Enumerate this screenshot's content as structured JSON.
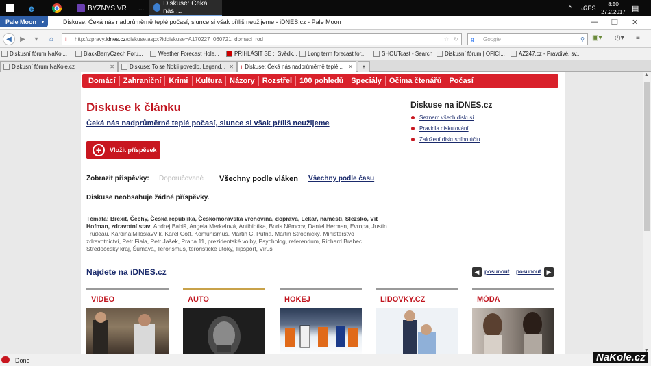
{
  "taskbar": {
    "items": [
      "BYZNYS VR",
      "...",
      "Diskuse: Čeká nás ..."
    ],
    "lang": "CES",
    "time": "8:50",
    "date": "27.2.2017"
  },
  "browser": {
    "app_button": "Pale Moon",
    "window_title": "Diskuse: Čeká nás nadprůměrně teplé počasí, slunce si však příliš neužijeme - iDNES.cz - Pale Moon",
    "url_prefix": "http://zpravy.",
    "url_domain": "idnes.cz",
    "url_path": "/diskuse.aspx?iddiskuse=A170227_060721_domaci_rod",
    "search_engine": "Google",
    "status": "Done"
  },
  "bookmarks": [
    "Diskusní fórum NaKol...",
    "BlackBerryCzech Foru...",
    "Weather Forecast Hole...",
    "PŘIHLÁSIT SE :: Svědk...",
    "Long term forecast for...",
    "SHOUTcast - Search",
    "Diskusní fórum | OFICI...",
    "AZ247.cz - Pravdivé, sv..."
  ],
  "tabs": [
    "Diskusní fórum NaKole.cz",
    "Diskuse: To se Nokii povedlo. Legend...",
    "Diskuse: Čeká nás nadprůměrně teplé..."
  ],
  "categories": [
    "Domácí",
    "Zahraniční",
    "Krimi",
    "Kultura",
    "Názory",
    "Rozstřel",
    "100 pohledů",
    "Speciály",
    "Očima čtenářů",
    "Počasí"
  ],
  "main": {
    "heading": "Diskuse k článku",
    "article_link": "Čeká nás nadprůměrně teplé počasí, slunce si však příliš neužijeme",
    "post_button": "Vložit příspěvek",
    "show_label": "Zobrazit příspěvky:",
    "filter_recommended": "Doporučované",
    "filter_threads": "Všechny podle vláken",
    "filter_time": "Všechny podle času",
    "empty_message": "Diskuse neobsahuje žádné příspěvky.",
    "tags_label": "Témata:",
    "tags_bold": "Brexit, Čechy, Česká republika, Českomoravská vrchovina, doprava, Lékař, náměstí, Slezsko, Vít Hofman, zdravotní stav",
    "tags_rest": ", Andrej Babiš, Angela Merkelová, Antibiotika, Boris Němcov, Daniel Herman, Evropa, Justin Trudeau, KardinálMiloslavVlk, Karel Gott, Komunismus, Martin C. Putna, Martin Stropnický, Ministerstvo zdravotnictví, Petr Fiala, Petr Jašek, Praha 11, prezidentské volby, Psycholog, referendum, Richard Brabec, Středočeský kraj, Šumava, Terorismus, teroristické útoky, Tipsport, Virus"
  },
  "sidebar": {
    "heading": "Diskuse na iDNES.cz",
    "links": [
      "Seznam všech diskusí",
      "Pravidla diskutování",
      "Založení diskusního účtu"
    ]
  },
  "najdete": {
    "heading": "Najdete na iDNES.cz",
    "prev": "posunout",
    "next": "posunout",
    "cards": [
      {
        "title": "VIDEO",
        "color": "#9a9a9a"
      },
      {
        "title": "AUTO",
        "color": "#c8a24a"
      },
      {
        "title": "HOKEJ",
        "color": "#9a9a9a"
      },
      {
        "title": "LIDOVKY.CZ",
        "color": "#9a9a9a"
      },
      {
        "title": "MÓDA",
        "color": "#9a9a9a"
      }
    ]
  },
  "watermark": "NaKole.cz",
  "colors": {
    "accent": "#d9212b",
    "link": "#1a2a6b"
  }
}
